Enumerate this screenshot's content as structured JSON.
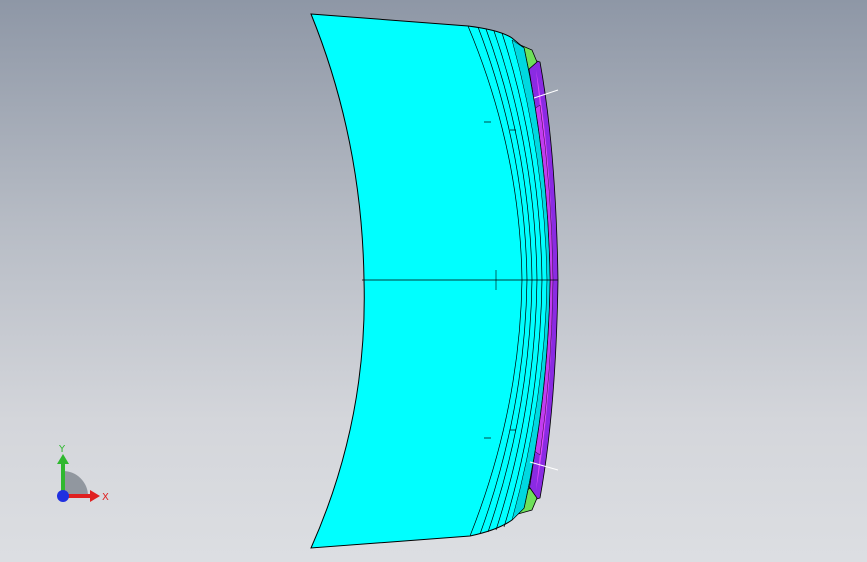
{
  "viewport": {
    "background_top": "#8e97a6",
    "background_bottom": "#dcdee2"
  },
  "model": {
    "description_color_main": "#00ffff",
    "color_edge": "#000000",
    "color_inner_bands": "#00e6e6",
    "color_ring": "#9b30ff",
    "color_ring_highlight": "#e040ff",
    "color_clips": "#5fdc4a"
  },
  "triad": {
    "y_label": "Y",
    "x_label": "X",
    "y_color": "#2fb82f",
    "x_color": "#e02020",
    "z_color": "#2030e0"
  }
}
